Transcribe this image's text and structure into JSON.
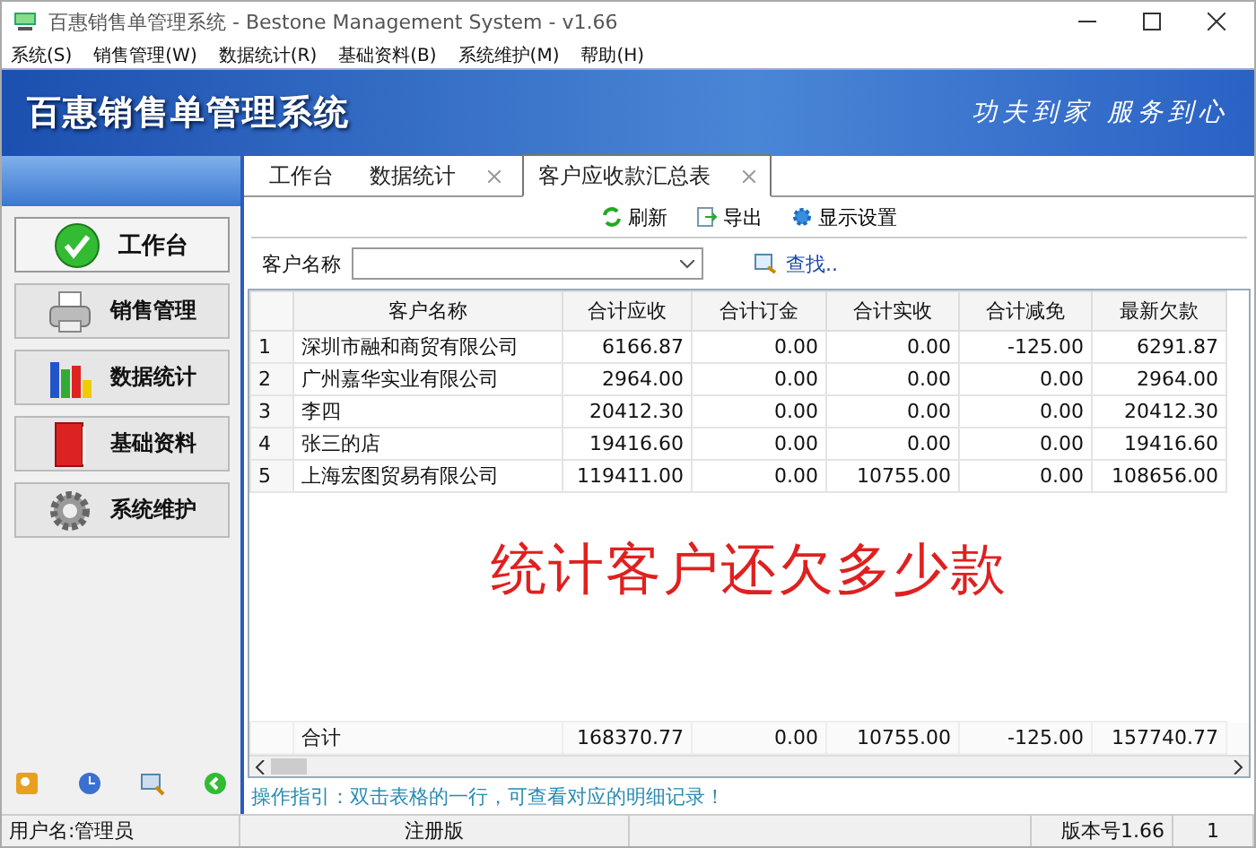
{
  "window": {
    "title": "百惠销售单管理系统 - Bestone Management System - v1.66"
  },
  "menu": [
    "系统(S)",
    "销售管理(W)",
    "数据统计(R)",
    "基础资料(B)",
    "系统维护(M)",
    "帮助(H)"
  ],
  "banner": {
    "title": "百惠销售单管理系统",
    "slogan": "功夫到家 服务到心"
  },
  "sidebar": {
    "items": [
      {
        "label": "工作台",
        "selected": true
      },
      {
        "label": "销售管理",
        "selected": false
      },
      {
        "label": "数据统计",
        "selected": false
      },
      {
        "label": "基础资料",
        "selected": false
      },
      {
        "label": "系统维护",
        "selected": false
      }
    ]
  },
  "tabs": [
    {
      "label": "工作台",
      "selected": false,
      "closable": false
    },
    {
      "label": "数据统计",
      "selected": false,
      "closable": true
    },
    {
      "label": "客户应收款汇总表",
      "selected": true,
      "closable": true
    }
  ],
  "toolbar": [
    "刷新",
    "导出",
    "显示设置"
  ],
  "filter": {
    "label": "客户名称",
    "find": "查找.."
  },
  "table": {
    "columns": [
      "",
      "客户名称",
      "合计应收",
      "合计订金",
      "合计实收",
      "合计减免",
      "最新欠款"
    ],
    "rows": [
      [
        "1",
        "深圳市融和商贸有限公司",
        "6166.87",
        "0.00",
        "0.00",
        "-125.00",
        "6291.87"
      ],
      [
        "2",
        "广州嘉华实业有限公司",
        "2964.00",
        "0.00",
        "0.00",
        "0.00",
        "2964.00"
      ],
      [
        "3",
        "李四",
        "20412.30",
        "0.00",
        "0.00",
        "0.00",
        "20412.30"
      ],
      [
        "4",
        "张三的店",
        "19416.60",
        "0.00",
        "0.00",
        "0.00",
        "19416.60"
      ],
      [
        "5",
        "上海宏图贸易有限公司",
        "119411.00",
        "0.00",
        "10755.00",
        "0.00",
        "108656.00"
      ]
    ],
    "total": [
      "合计",
      "168370.77",
      "0.00",
      "10755.00",
      "-125.00",
      "157740.77"
    ]
  },
  "annotation": "统计客户还欠多少款",
  "hint": "操作指引：双击表格的一行，可查看对应的明细记录！",
  "status_bar": [
    "用户名:管理员",
    "注册版",
    "版本号1.66",
    "1"
  ]
}
